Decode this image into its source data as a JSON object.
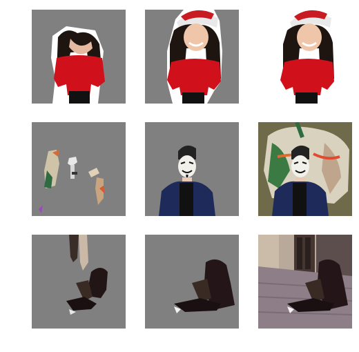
{
  "grid": {
    "rows": 3,
    "columns": 3,
    "background_color": "#ffffff",
    "masked_background_color": "#808080"
  },
  "rows": [
    {
      "subject": "woman-in-santa-hat",
      "cells": [
        {
          "kind": "partial-mask",
          "background": "gray"
        },
        {
          "kind": "full-mask",
          "background": "gray"
        },
        {
          "kind": "original",
          "background": "white"
        }
      ]
    },
    {
      "subject": "man-in-mask-by-graffiti",
      "cells": [
        {
          "kind": "partial-mask",
          "background": "gray"
        },
        {
          "kind": "full-mask",
          "background": "gray"
        },
        {
          "kind": "original",
          "background": "graffiti-wall"
        }
      ]
    },
    {
      "subject": "person-sitting-on-cobblestones",
      "cells": [
        {
          "kind": "partial-mask",
          "background": "gray"
        },
        {
          "kind": "full-mask",
          "background": "gray"
        },
        {
          "kind": "original",
          "background": "street"
        }
      ]
    }
  ]
}
